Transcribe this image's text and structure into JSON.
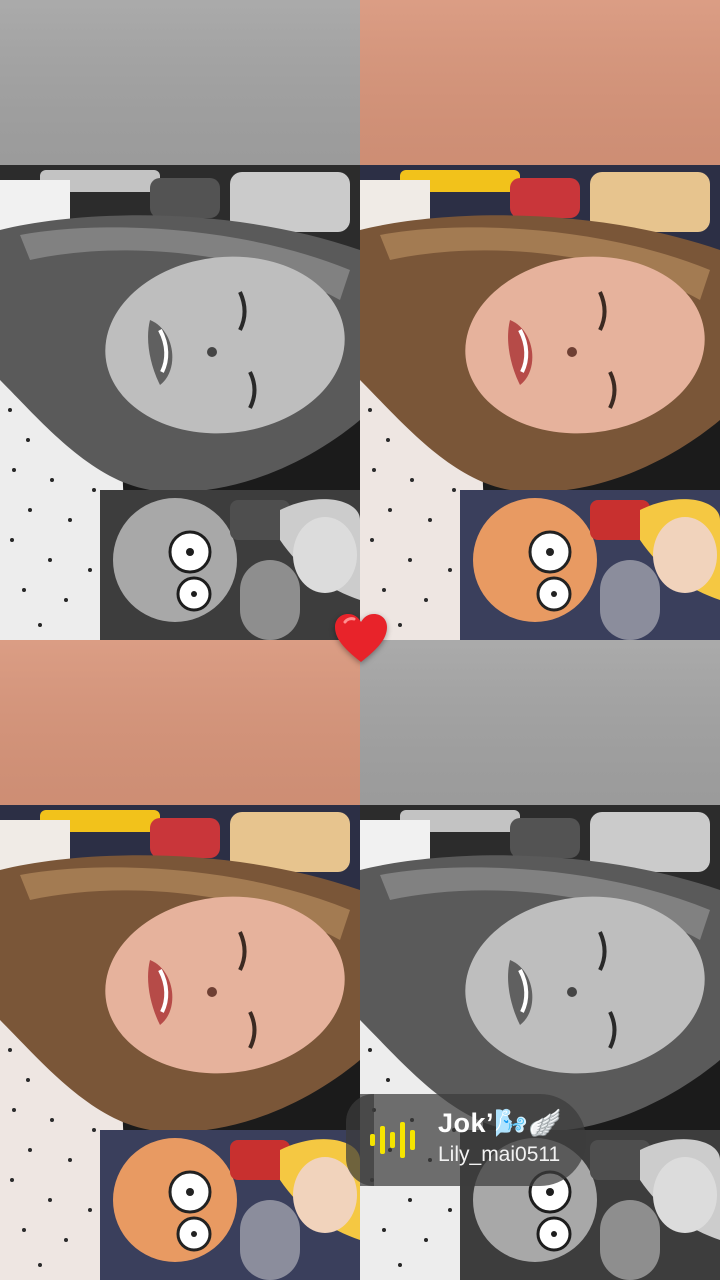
{
  "tiles": [
    {
      "name": "top-left",
      "style": "grayscale"
    },
    {
      "name": "top-right",
      "style": "color"
    },
    {
      "name": "bottom-left",
      "style": "color"
    },
    {
      "name": "bottom-right",
      "style": "grayscale"
    }
  ],
  "overlay": {
    "like_icon": "heart-icon",
    "like_color": "#e8232a"
  },
  "music": {
    "icon": "equalizer-icon",
    "accent_color": "#f5e400",
    "title": "Jok’🌬️🪽",
    "user": "Lily_mai0511"
  }
}
